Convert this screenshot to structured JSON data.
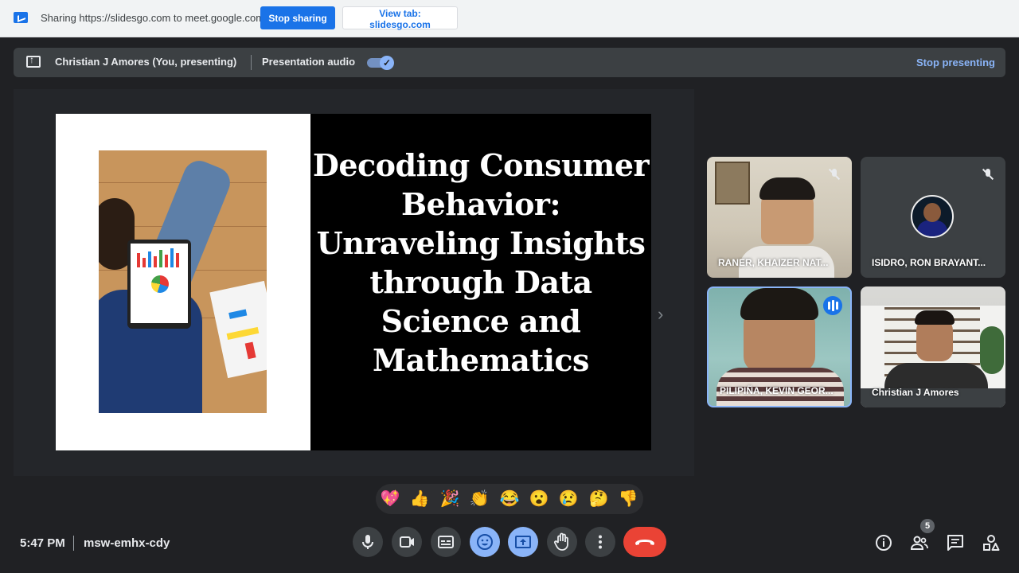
{
  "share_bar": {
    "text": "Sharing https://slidesgo.com to meet.google.com",
    "stop_label": "Stop sharing",
    "view_label": "View tab: slidesgo.com"
  },
  "presenting_bar": {
    "name": "Christian J Amores (You, presenting)",
    "audio_label": "Presentation audio",
    "audio_enabled": true,
    "stop_label": "Stop presenting"
  },
  "slide": {
    "title_lines": [
      "Decoding Consumer",
      "Behavior:",
      "Unraveling Insights",
      "through Data",
      "Science and",
      "Mathematics"
    ]
  },
  "participants": [
    {
      "name": "RANER, KHAIZER NAT...",
      "muted": true
    },
    {
      "name": "ISIDRO, RON BRAYANT...",
      "muted": true
    },
    {
      "name": "PILIPIÑA, KEVIN GEOR...",
      "speaking": true
    },
    {
      "name": "Christian J Amores"
    }
  ],
  "reactions": [
    "💖",
    "👍",
    "🎉",
    "👏",
    "😂",
    "😮",
    "😢",
    "🤔",
    "👎"
  ],
  "meeting": {
    "time": "5:47 PM",
    "code": "msw-emhx-cdy",
    "participant_count": "5"
  },
  "colors": {
    "background": "#202124",
    "accent": "#8ab4f8",
    "primary": "#1a73e8",
    "end_call": "#ea4335"
  },
  "icons": {
    "controls": [
      "mic-icon",
      "camera-icon",
      "captions-icon",
      "emoji-icon",
      "present-icon",
      "raise-hand-icon",
      "more-icon",
      "end-call-icon"
    ],
    "right": [
      "info-icon",
      "people-icon",
      "chat-icon",
      "activities-icon"
    ]
  }
}
